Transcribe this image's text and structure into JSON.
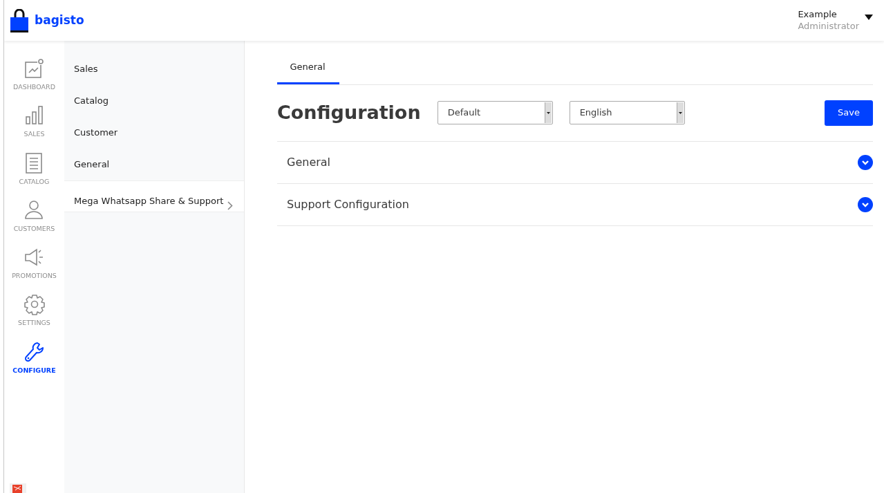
{
  "brand": {
    "name": "bagisto"
  },
  "user": {
    "name": "Example",
    "role": "Administrator"
  },
  "nav": [
    {
      "kind": "dashboard",
      "label": "DASHBOARD",
      "selected": false
    },
    {
      "kind": "sales",
      "label": "SALES",
      "selected": false
    },
    {
      "kind": "catalog",
      "label": "CATALOG",
      "selected": false
    },
    {
      "kind": "customers",
      "label": "CUSTOMERS",
      "selected": false
    },
    {
      "kind": "promotions",
      "label": "PROMOTIONS",
      "selected": false
    },
    {
      "kind": "settings",
      "label": "SETTINGS",
      "selected": false
    },
    {
      "kind": "configure",
      "label": "CONFIGURE",
      "selected": true
    }
  ],
  "submenu": [
    {
      "label": "Sales",
      "selected": false
    },
    {
      "label": "Catalog",
      "selected": false
    },
    {
      "label": "Customer",
      "selected": false
    },
    {
      "label": "General",
      "selected": false
    },
    {
      "label": "Mega Whatsapp Share & Support",
      "selected": true
    }
  ],
  "tabs": [
    {
      "label": "General",
      "selected": true
    }
  ],
  "page": {
    "title": "Configuration",
    "channel": "Default",
    "locale": "English",
    "save": "Save"
  },
  "sections": [
    {
      "title": "General",
      "expanded": false
    },
    {
      "title": "Support Configuration",
      "expanded": false
    }
  ]
}
